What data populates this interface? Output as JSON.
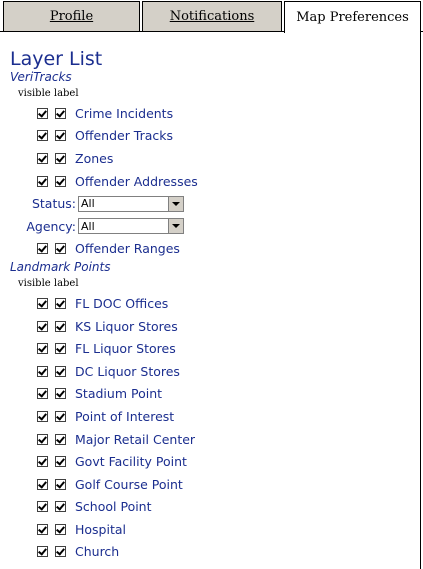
{
  "tabs": [
    {
      "label": "Profile"
    },
    {
      "label": "Notifications"
    },
    {
      "label": "Map Preferences"
    }
  ],
  "title": "Layer List",
  "columns_header": "visible label",
  "groups": [
    {
      "name": "VeriTracks",
      "layers": [
        {
          "label": "Crime Incidents",
          "visible": true,
          "show_label": true
        },
        {
          "label": "Offender Tracks",
          "visible": true,
          "show_label": true
        },
        {
          "label": "Zones",
          "visible": true,
          "show_label": true
        },
        {
          "label": "Offender Addresses",
          "visible": true,
          "show_label": true
        }
      ],
      "filters": [
        {
          "label": "Status:",
          "value": "All"
        },
        {
          "label": "Agency:",
          "value": "All"
        }
      ],
      "after_filters": [
        {
          "label": "Offender Ranges",
          "visible": true,
          "show_label": true
        }
      ]
    },
    {
      "name": "Landmark Points",
      "layers": [
        {
          "label": "FL DOC Offices",
          "visible": true,
          "show_label": true
        },
        {
          "label": "KS Liquor Stores",
          "visible": true,
          "show_label": true
        },
        {
          "label": "FL Liquor Stores",
          "visible": true,
          "show_label": true
        },
        {
          "label": "DC Liquor Stores",
          "visible": true,
          "show_label": true
        },
        {
          "label": "Stadium Point",
          "visible": true,
          "show_label": true
        },
        {
          "label": "Point of Interest",
          "visible": true,
          "show_label": true
        },
        {
          "label": "Major Retail Center",
          "visible": true,
          "show_label": true
        },
        {
          "label": "Govt Facility Point",
          "visible": true,
          "show_label": true
        },
        {
          "label": "Golf Course Point",
          "visible": true,
          "show_label": true
        },
        {
          "label": "School Point",
          "visible": true,
          "show_label": true
        },
        {
          "label": "Hospital",
          "visible": true,
          "show_label": true
        },
        {
          "label": "Church",
          "visible": true,
          "show_label": true
        }
      ]
    }
  ]
}
